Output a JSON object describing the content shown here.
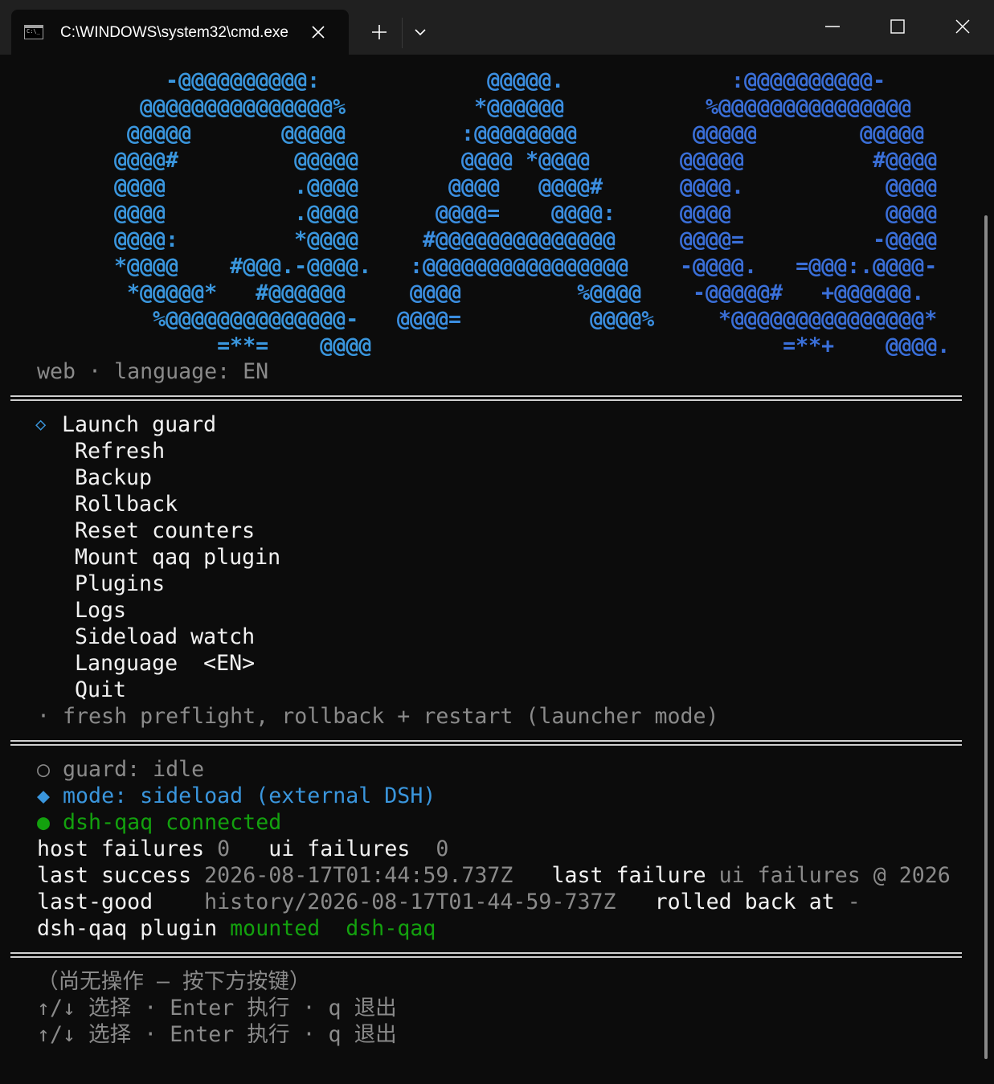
{
  "window": {
    "tab_title": "C:\\WINDOWS\\system32\\cmd.exe",
    "tab_icon_text": "C:\\_",
    "icons": {
      "tab": "cmd-icon",
      "close_tab": "close-icon",
      "new_tab": "plus-icon",
      "dropdown": "chevron-down-icon",
      "minimize": "minimize-icon",
      "maximize": "maximize-icon",
      "close_window": "close-icon"
    }
  },
  "logo": {
    "letters": [
      "Q",
      "A",
      "Q"
    ],
    "colors": [
      "#3a96dd",
      "#3b8ee0",
      "#3a6fd8"
    ],
    "q_art": "    -@@@@@@@@@@:\n  @@@@@@@@@@@@@@@%\n @@@@@       @@@@@\n@@@@#         @@@@@\n@@@@          .@@@@\n@@@@          .@@@@\n@@@@:         *@@@@\n*@@@@    #@@@.-@@@@.\n *@@@@@*   #@@@@@@\n   %@@@@@@@@@@@@@@-\n        =**=    @@@@",
    "a_art": "       @@@@@.\n      *@@@@@@\n     :@@@@@@@@\n     @@@@ *@@@@\n    @@@@   @@@@#\n   @@@@=    @@@@:\n  #@@@@@@@@@@@@@@\n :@@@@@@@@@@@@@@@@\n @@@@         %@@@@\n@@@@=          @@@@%",
    "q2_art": "    :@@@@@@@@@@-\n  %@@@@@@@@@@@@@@@\n @@@@@        @@@@@\n@@@@@          #@@@@\n@@@@.           @@@@\n@@@@            @@@@\n@@@@=          -@@@@\n-@@@@.   =@@@:.@@@@-\n -@@@@@#   +@@@@@@.\n   *@@@@@@@@@@@@@@@*\n        =**+    @@@@."
  },
  "subtitle": "web · language: EN",
  "menu": {
    "selected_marker": "◇",
    "items": [
      "Launch guard",
      "Refresh",
      "Backup",
      "Rollback",
      "Reset counters",
      "Mount qaq plugin",
      "Plugins",
      "Logs",
      "Sideload watch",
      "Language  <EN>",
      "Quit"
    ],
    "hint": "· fresh preflight, rollback + restart (launcher mode)"
  },
  "status": {
    "guard_marker": "○",
    "guard": "guard: idle",
    "mode_marker": "◆",
    "mode": "mode: sideload (external DSH)",
    "conn_marker": "●",
    "connection": "dsh-qaq connected",
    "host_failures_label": "host failures",
    "host_failures_value": "0",
    "ui_failures_label": "ui failures",
    "ui_failures_value": "0",
    "last_success_label": "last success",
    "last_success_value": "2026-08-17T01:44:59.737Z",
    "last_failure_label": "last failure",
    "last_failure_value": "ui failures @ 2026",
    "last_good_label": "last-good",
    "last_good_value": "history/2026-08-17T01-44-59-737Z",
    "rolled_back_label": "rolled back at",
    "rolled_back_value": "-",
    "plugin_label": "dsh-qaq plugin",
    "plugin_state": "mounted",
    "plugin_name": "dsh-qaq",
    "colors": {
      "idle": "#8a8a8a",
      "mode": "#3a96dd",
      "connected": "#13a10e"
    }
  },
  "footer": {
    "no_action": "（尚无操作 – 按下方按键）",
    "keys_line1": "↑/↓ 选择 · Enter 执行 · q 退出",
    "keys_line2": "↑/↓ 选择 · Enter 执行 · q 退出"
  }
}
